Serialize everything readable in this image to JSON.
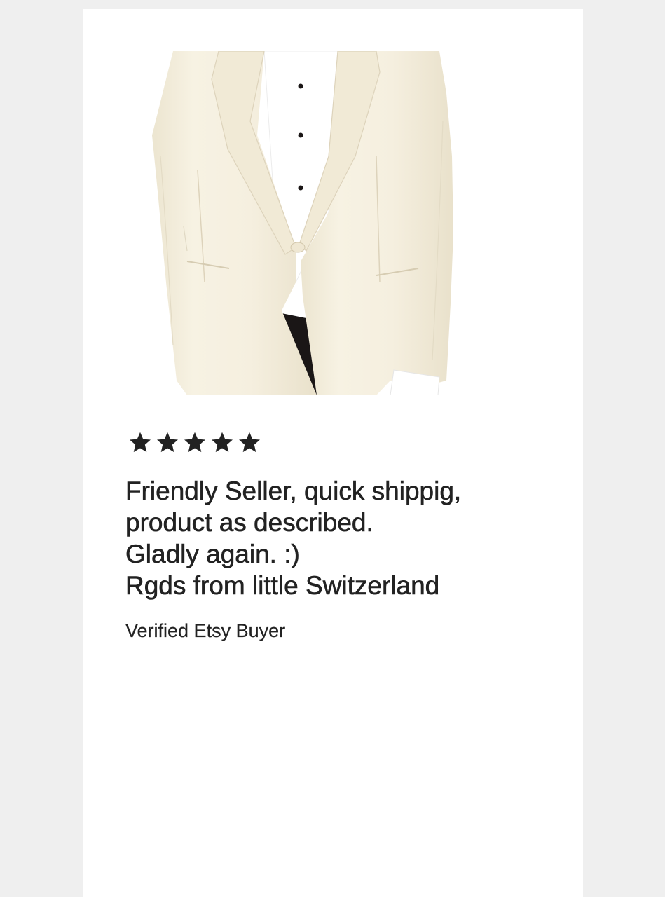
{
  "review": {
    "product_image_alt": "Ivory shawl-collar dinner jacket",
    "rating": 5,
    "rating_max": 5,
    "lines": [
      "Friendly Seller, quick shippig,",
      "product as described.",
      "Gladly again. :)",
      "Rgds from little Switzerland"
    ],
    "buyer": "Verified Etsy Buyer"
  },
  "colors": {
    "page_background": "#efefef",
    "card_background": "#ffffff",
    "text": "#222222",
    "star": "#222222",
    "jacket": "#f6f1e1",
    "shirt": "#ffffff",
    "trousers": "#1a1616"
  },
  "icons": [
    "star-icon"
  ]
}
